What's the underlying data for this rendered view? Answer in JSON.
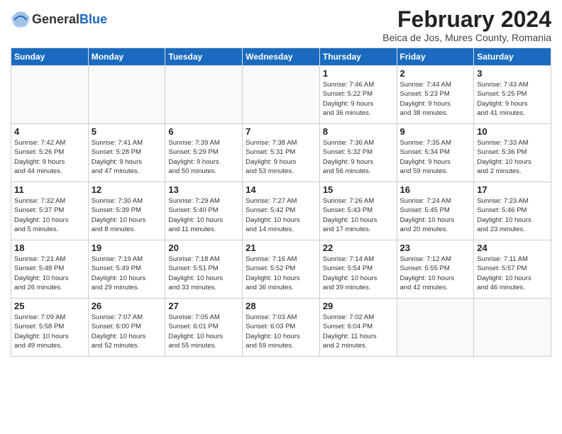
{
  "header": {
    "logo_line1": "General",
    "logo_line2": "Blue",
    "month_year": "February 2024",
    "location": "Beica de Jos, Mures County, Romania"
  },
  "days_of_week": [
    "Sunday",
    "Monday",
    "Tuesday",
    "Wednesday",
    "Thursday",
    "Friday",
    "Saturday"
  ],
  "weeks": [
    [
      {
        "day": "",
        "info": ""
      },
      {
        "day": "",
        "info": ""
      },
      {
        "day": "",
        "info": ""
      },
      {
        "day": "",
        "info": ""
      },
      {
        "day": "1",
        "info": "Sunrise: 7:46 AM\nSunset: 5:22 PM\nDaylight: 9 hours\nand 36 minutes."
      },
      {
        "day": "2",
        "info": "Sunrise: 7:44 AM\nSunset: 5:23 PM\nDaylight: 9 hours\nand 38 minutes."
      },
      {
        "day": "3",
        "info": "Sunrise: 7:43 AM\nSunset: 5:25 PM\nDaylight: 9 hours\nand 41 minutes."
      }
    ],
    [
      {
        "day": "4",
        "info": "Sunrise: 7:42 AM\nSunset: 5:26 PM\nDaylight: 9 hours\nand 44 minutes."
      },
      {
        "day": "5",
        "info": "Sunrise: 7:41 AM\nSunset: 5:28 PM\nDaylight: 9 hours\nand 47 minutes."
      },
      {
        "day": "6",
        "info": "Sunrise: 7:39 AM\nSunset: 5:29 PM\nDaylight: 9 hours\nand 50 minutes."
      },
      {
        "day": "7",
        "info": "Sunrise: 7:38 AM\nSunset: 5:31 PM\nDaylight: 9 hours\nand 53 minutes."
      },
      {
        "day": "8",
        "info": "Sunrise: 7:36 AM\nSunset: 5:32 PM\nDaylight: 9 hours\nand 56 minutes."
      },
      {
        "day": "9",
        "info": "Sunrise: 7:35 AM\nSunset: 5:34 PM\nDaylight: 9 hours\nand 59 minutes."
      },
      {
        "day": "10",
        "info": "Sunrise: 7:33 AM\nSunset: 5:36 PM\nDaylight: 10 hours\nand 2 minutes."
      }
    ],
    [
      {
        "day": "11",
        "info": "Sunrise: 7:32 AM\nSunset: 5:37 PM\nDaylight: 10 hours\nand 5 minutes."
      },
      {
        "day": "12",
        "info": "Sunrise: 7:30 AM\nSunset: 5:39 PM\nDaylight: 10 hours\nand 8 minutes."
      },
      {
        "day": "13",
        "info": "Sunrise: 7:29 AM\nSunset: 5:40 PM\nDaylight: 10 hours\nand 11 minutes."
      },
      {
        "day": "14",
        "info": "Sunrise: 7:27 AM\nSunset: 5:42 PM\nDaylight: 10 hours\nand 14 minutes."
      },
      {
        "day": "15",
        "info": "Sunrise: 7:26 AM\nSunset: 5:43 PM\nDaylight: 10 hours\nand 17 minutes."
      },
      {
        "day": "16",
        "info": "Sunrise: 7:24 AM\nSunset: 5:45 PM\nDaylight: 10 hours\nand 20 minutes."
      },
      {
        "day": "17",
        "info": "Sunrise: 7:23 AM\nSunset: 5:46 PM\nDaylight: 10 hours\nand 23 minutes."
      }
    ],
    [
      {
        "day": "18",
        "info": "Sunrise: 7:21 AM\nSunset: 5:48 PM\nDaylight: 10 hours\nand 26 minutes."
      },
      {
        "day": "19",
        "info": "Sunrise: 7:19 AM\nSunset: 5:49 PM\nDaylight: 10 hours\nand 29 minutes."
      },
      {
        "day": "20",
        "info": "Sunrise: 7:18 AM\nSunset: 5:51 PM\nDaylight: 10 hours\nand 33 minutes."
      },
      {
        "day": "21",
        "info": "Sunrise: 7:16 AM\nSunset: 5:52 PM\nDaylight: 10 hours\nand 36 minutes."
      },
      {
        "day": "22",
        "info": "Sunrise: 7:14 AM\nSunset: 5:54 PM\nDaylight: 10 hours\nand 39 minutes."
      },
      {
        "day": "23",
        "info": "Sunrise: 7:12 AM\nSunset: 5:55 PM\nDaylight: 10 hours\nand 42 minutes."
      },
      {
        "day": "24",
        "info": "Sunrise: 7:11 AM\nSunset: 5:57 PM\nDaylight: 10 hours\nand 46 minutes."
      }
    ],
    [
      {
        "day": "25",
        "info": "Sunrise: 7:09 AM\nSunset: 5:58 PM\nDaylight: 10 hours\nand 49 minutes."
      },
      {
        "day": "26",
        "info": "Sunrise: 7:07 AM\nSunset: 6:00 PM\nDaylight: 10 hours\nand 52 minutes."
      },
      {
        "day": "27",
        "info": "Sunrise: 7:05 AM\nSunset: 6:01 PM\nDaylight: 10 hours\nand 55 minutes."
      },
      {
        "day": "28",
        "info": "Sunrise: 7:03 AM\nSunset: 6:03 PM\nDaylight: 10 hours\nand 59 minutes."
      },
      {
        "day": "29",
        "info": "Sunrise: 7:02 AM\nSunset: 6:04 PM\nDaylight: 11 hours\nand 2 minutes."
      },
      {
        "day": "",
        "info": ""
      },
      {
        "day": "",
        "info": ""
      }
    ]
  ]
}
